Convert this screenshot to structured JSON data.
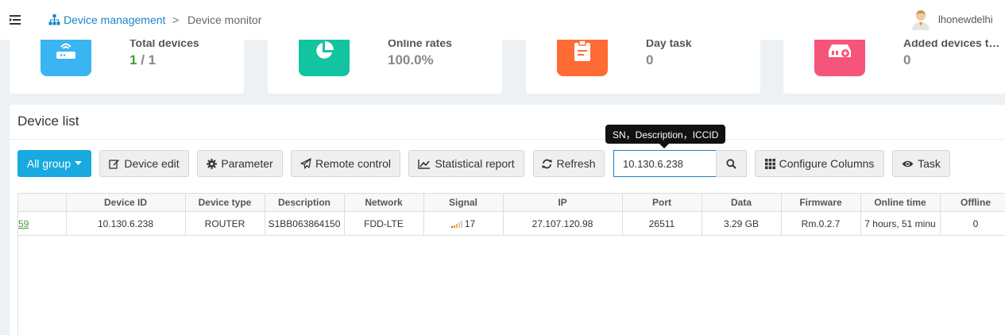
{
  "header": {
    "breadcrumb_link": "Device management",
    "breadcrumb_sep": ">",
    "breadcrumb_current": "Device monitor",
    "user_name": "lhonewdelhi"
  },
  "stats": [
    {
      "label": "Total devices",
      "value_hi": "1",
      "value_rest": " / 1",
      "color": "#3bb4f2",
      "icon": "router-icon"
    },
    {
      "label": "Online rates",
      "value": "100.0%",
      "color": "#12c4a0",
      "icon": "pie-chart-icon"
    },
    {
      "label": "Day task",
      "value": "0",
      "color": "#ff6a35",
      "icon": "clipboard-icon"
    },
    {
      "label": "Added devices t…",
      "value": "0",
      "color": "#f5557a",
      "icon": "add-device-icon"
    }
  ],
  "panel": {
    "title": "Device list",
    "buttons": {
      "group": "All group",
      "edit": "Device edit",
      "parameter": "Parameter",
      "remote": "Remote control",
      "report": "Statistical report",
      "refresh": "Refresh",
      "columns": "Configure Columns",
      "task": "Task"
    },
    "search": {
      "value": "10.130.6.238",
      "tooltip": "SN，Description，ICCID"
    }
  },
  "table": {
    "headers": [
      "",
      "Device ID",
      "Device type",
      "Description",
      "Network",
      "Signal",
      "IP",
      "Port",
      "Data",
      "Firmware",
      "Online time",
      "Offline"
    ],
    "rows": [
      {
        "id_link": "59",
        "device_id": "10.130.6.238",
        "type": "ROUTER",
        "description": "S1BB063864150",
        "network": "FDD-LTE",
        "signal": "17",
        "ip": "27.107.120.98",
        "port": "26511",
        "data": "3.29 GB",
        "firmware": "Rm.0.2.7",
        "online_time": "7 hours, 51 minu",
        "offline": "0"
      }
    ]
  }
}
